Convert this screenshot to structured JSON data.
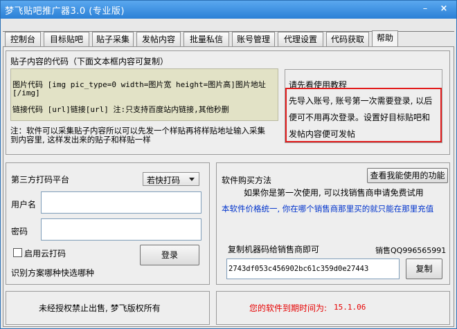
{
  "window": {
    "title": "梦飞贴吧推广器3.0 (专业版)",
    "minimize": "–",
    "close": "×"
  },
  "tabs": [
    {
      "label": "控制台"
    },
    {
      "label": "目标贴吧"
    },
    {
      "label": "贴子采集"
    },
    {
      "label": "发帖内容"
    },
    {
      "label": "批量私信"
    },
    {
      "label": "账号管理"
    },
    {
      "label": "代理设置"
    },
    {
      "label": "代码获取"
    },
    {
      "label": "帮助",
      "active": true
    }
  ],
  "code_section": {
    "heading": "贴子内容的代码（下面文本框内容可复制）",
    "image_code_line1": "图片代码 [img pic_type=0 width=图片宽 height=图片高]图片地址",
    "image_code_line2": "[/img]",
    "link_code": "链接代码 [url]链接[url] 注:只支持百度站内链接,其他秒删",
    "note_line1": "注：软件可以采集贴子内容所以可以先发一个样贴再将样贴地址输入采集",
    "note_line2": "到内容里, 这样发出来的贴子和样贴一样"
  },
  "help_section": {
    "title": "请先看使用教程",
    "line1": "先导入账号, 账号第一次需要登录, 以后",
    "line2": "便可不用再次登录。设置好目标贴吧和",
    "line3": "发帖内容便可发帖"
  },
  "captcha_section": {
    "platform_label": "第三方打码平台",
    "platform_selected": "若快打码",
    "username_label": "用户名",
    "username_value": "",
    "password_label": "密码",
    "password_value": "",
    "cloud_checkbox_label": "启用云打码",
    "cloud_checked": false,
    "login_button": "登录",
    "hint": "识别方案哪种快选哪种"
  },
  "purchase_section": {
    "title": "软件购买方法",
    "view_features_button": "查看我能使用的功能",
    "line_first_use": "如果你是第一次使用, 可以找销售商申请免费试用",
    "line_price": "本软件价格统一, 你在哪个销售商那里买的就只能在那里充值",
    "copy_prompt": "复制机器码给销售商即可",
    "seller_qq": "销售QQ996565991",
    "machine_code": "2743df053c456902bc61c359d0e27443",
    "copy_button": "复制"
  },
  "footer": {
    "copyright": "未经授权禁止出售, 梦飞版权所有",
    "expiry_label": "您的软件到期时间为:",
    "expiry_date": "15.1.06"
  }
}
